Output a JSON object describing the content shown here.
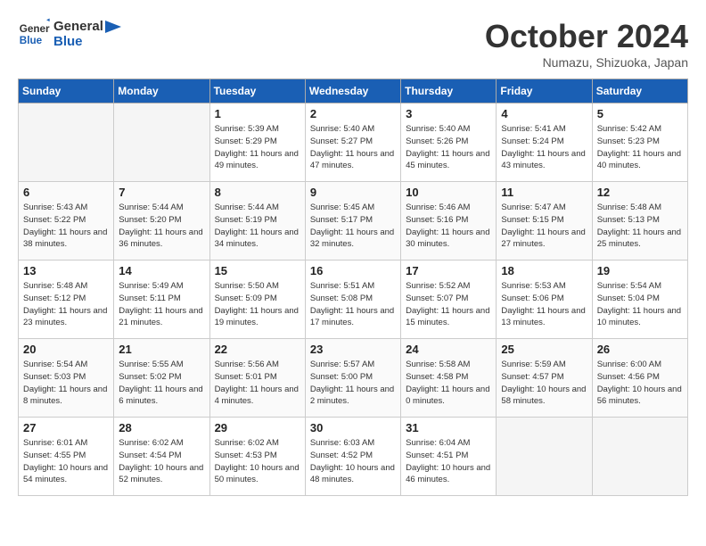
{
  "header": {
    "logo_line1": "General",
    "logo_line2": "Blue",
    "month": "October 2024",
    "location": "Numazu, Shizuoka, Japan"
  },
  "weekdays": [
    "Sunday",
    "Monday",
    "Tuesday",
    "Wednesday",
    "Thursday",
    "Friday",
    "Saturday"
  ],
  "weeks": [
    [
      {
        "day": "",
        "info": ""
      },
      {
        "day": "",
        "info": ""
      },
      {
        "day": "1",
        "info": "Sunrise: 5:39 AM\nSunset: 5:29 PM\nDaylight: 11 hours and 49 minutes."
      },
      {
        "day": "2",
        "info": "Sunrise: 5:40 AM\nSunset: 5:27 PM\nDaylight: 11 hours and 47 minutes."
      },
      {
        "day": "3",
        "info": "Sunrise: 5:40 AM\nSunset: 5:26 PM\nDaylight: 11 hours and 45 minutes."
      },
      {
        "day": "4",
        "info": "Sunrise: 5:41 AM\nSunset: 5:24 PM\nDaylight: 11 hours and 43 minutes."
      },
      {
        "day": "5",
        "info": "Sunrise: 5:42 AM\nSunset: 5:23 PM\nDaylight: 11 hours and 40 minutes."
      }
    ],
    [
      {
        "day": "6",
        "info": "Sunrise: 5:43 AM\nSunset: 5:22 PM\nDaylight: 11 hours and 38 minutes."
      },
      {
        "day": "7",
        "info": "Sunrise: 5:44 AM\nSunset: 5:20 PM\nDaylight: 11 hours and 36 minutes."
      },
      {
        "day": "8",
        "info": "Sunrise: 5:44 AM\nSunset: 5:19 PM\nDaylight: 11 hours and 34 minutes."
      },
      {
        "day": "9",
        "info": "Sunrise: 5:45 AM\nSunset: 5:17 PM\nDaylight: 11 hours and 32 minutes."
      },
      {
        "day": "10",
        "info": "Sunrise: 5:46 AM\nSunset: 5:16 PM\nDaylight: 11 hours and 30 minutes."
      },
      {
        "day": "11",
        "info": "Sunrise: 5:47 AM\nSunset: 5:15 PM\nDaylight: 11 hours and 27 minutes."
      },
      {
        "day": "12",
        "info": "Sunrise: 5:48 AM\nSunset: 5:13 PM\nDaylight: 11 hours and 25 minutes."
      }
    ],
    [
      {
        "day": "13",
        "info": "Sunrise: 5:48 AM\nSunset: 5:12 PM\nDaylight: 11 hours and 23 minutes."
      },
      {
        "day": "14",
        "info": "Sunrise: 5:49 AM\nSunset: 5:11 PM\nDaylight: 11 hours and 21 minutes."
      },
      {
        "day": "15",
        "info": "Sunrise: 5:50 AM\nSunset: 5:09 PM\nDaylight: 11 hours and 19 minutes."
      },
      {
        "day": "16",
        "info": "Sunrise: 5:51 AM\nSunset: 5:08 PM\nDaylight: 11 hours and 17 minutes."
      },
      {
        "day": "17",
        "info": "Sunrise: 5:52 AM\nSunset: 5:07 PM\nDaylight: 11 hours and 15 minutes."
      },
      {
        "day": "18",
        "info": "Sunrise: 5:53 AM\nSunset: 5:06 PM\nDaylight: 11 hours and 13 minutes."
      },
      {
        "day": "19",
        "info": "Sunrise: 5:54 AM\nSunset: 5:04 PM\nDaylight: 11 hours and 10 minutes."
      }
    ],
    [
      {
        "day": "20",
        "info": "Sunrise: 5:54 AM\nSunset: 5:03 PM\nDaylight: 11 hours and 8 minutes."
      },
      {
        "day": "21",
        "info": "Sunrise: 5:55 AM\nSunset: 5:02 PM\nDaylight: 11 hours and 6 minutes."
      },
      {
        "day": "22",
        "info": "Sunrise: 5:56 AM\nSunset: 5:01 PM\nDaylight: 11 hours and 4 minutes."
      },
      {
        "day": "23",
        "info": "Sunrise: 5:57 AM\nSunset: 5:00 PM\nDaylight: 11 hours and 2 minutes."
      },
      {
        "day": "24",
        "info": "Sunrise: 5:58 AM\nSunset: 4:58 PM\nDaylight: 11 hours and 0 minutes."
      },
      {
        "day": "25",
        "info": "Sunrise: 5:59 AM\nSunset: 4:57 PM\nDaylight: 10 hours and 58 minutes."
      },
      {
        "day": "26",
        "info": "Sunrise: 6:00 AM\nSunset: 4:56 PM\nDaylight: 10 hours and 56 minutes."
      }
    ],
    [
      {
        "day": "27",
        "info": "Sunrise: 6:01 AM\nSunset: 4:55 PM\nDaylight: 10 hours and 54 minutes."
      },
      {
        "day": "28",
        "info": "Sunrise: 6:02 AM\nSunset: 4:54 PM\nDaylight: 10 hours and 52 minutes."
      },
      {
        "day": "29",
        "info": "Sunrise: 6:02 AM\nSunset: 4:53 PM\nDaylight: 10 hours and 50 minutes."
      },
      {
        "day": "30",
        "info": "Sunrise: 6:03 AM\nSunset: 4:52 PM\nDaylight: 10 hours and 48 minutes."
      },
      {
        "day": "31",
        "info": "Sunrise: 6:04 AM\nSunset: 4:51 PM\nDaylight: 10 hours and 46 minutes."
      },
      {
        "day": "",
        "info": ""
      },
      {
        "day": "",
        "info": ""
      }
    ]
  ]
}
